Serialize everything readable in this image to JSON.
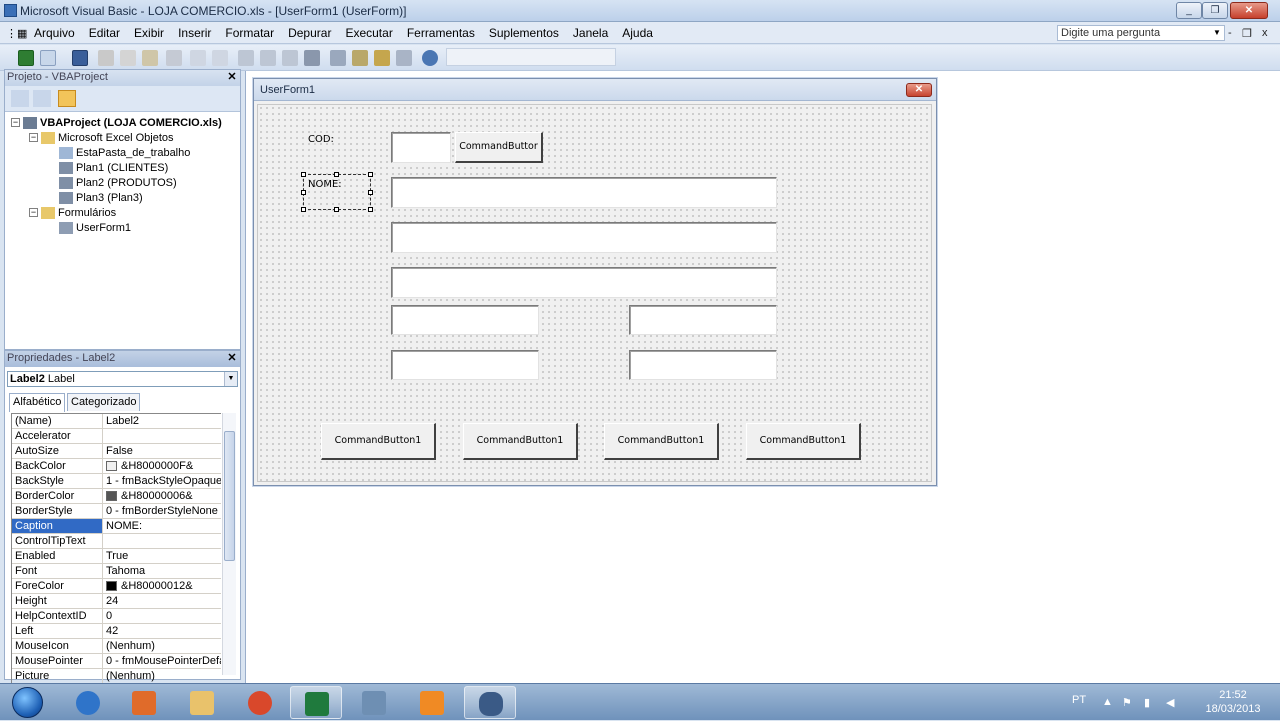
{
  "window": {
    "title": "Microsoft Visual Basic - LOJA COMERCIO.xls - [UserForm1 (UserForm)]",
    "minimize": "_",
    "restore": "❐",
    "close": "✕"
  },
  "menu": {
    "items": [
      "Arquivo",
      "Editar",
      "Exibir",
      "Inserir",
      "Formatar",
      "Depurar",
      "Executar",
      "Ferramentas",
      "Suplementos",
      "Janela",
      "Ajuda"
    ],
    "ask_placeholder": "Digite uma pergunta",
    "mdi_min": "-",
    "mdi_restore": "❐",
    "mdi_close": "x"
  },
  "project": {
    "header": "Projeto - VBAProject",
    "close": "✕",
    "tree": {
      "root": "VBAProject (LOJA COMERCIO.xls)",
      "folder_objects": "Microsoft Excel Objetos",
      "workbook": "EstaPasta_de_trabalho",
      "sheets": [
        "Plan1 (CLIENTES)",
        "Plan2 (PRODUTOS)",
        "Plan3 (Plan3)"
      ],
      "folder_forms": "Formulários",
      "form": "UserForm1"
    }
  },
  "properties": {
    "header": "Propriedades - Label2",
    "close": "✕",
    "object_name": "Label2",
    "object_type": "Label",
    "tabs": [
      "Alfabético",
      "Categorizado"
    ],
    "rows": [
      {
        "name": "(Name)",
        "value": "Label2"
      },
      {
        "name": "Accelerator",
        "value": ""
      },
      {
        "name": "AutoSize",
        "value": "False"
      },
      {
        "name": "BackColor",
        "value": "&H8000000F&",
        "swatch": "#f0f0f0"
      },
      {
        "name": "BackStyle",
        "value": "1 - fmBackStyleOpaque"
      },
      {
        "name": "BorderColor",
        "value": "&H80000006&",
        "swatch": "#555555"
      },
      {
        "name": "BorderStyle",
        "value": "0 - fmBorderStyleNone"
      },
      {
        "name": "Caption",
        "value": "NOME:"
      },
      {
        "name": "ControlTipText",
        "value": ""
      },
      {
        "name": "Enabled",
        "value": "True"
      },
      {
        "name": "Font",
        "value": "Tahoma"
      },
      {
        "name": "ForeColor",
        "value": "&H80000012&",
        "swatch": "#000000"
      },
      {
        "name": "Height",
        "value": "24"
      },
      {
        "name": "HelpContextID",
        "value": "0"
      },
      {
        "name": "Left",
        "value": "42"
      },
      {
        "name": "MouseIcon",
        "value": "(Nenhum)"
      },
      {
        "name": "MousePointer",
        "value": "0 - fmMousePointerDefau"
      },
      {
        "name": "Picture",
        "value": "(Nenhum)"
      }
    ],
    "selected_row": "Caption"
  },
  "userform": {
    "title": "UserForm1",
    "close": "✕",
    "label_cod": "COD:",
    "label_nome": "NOME:",
    "btn_search": "CommandButtor",
    "bottom_buttons": [
      "CommandButton1",
      "CommandButton1",
      "CommandButton1",
      "CommandButton1"
    ]
  },
  "taskbar": {
    "lang": "PT",
    "time": "21:52",
    "date": "18/03/2013"
  }
}
